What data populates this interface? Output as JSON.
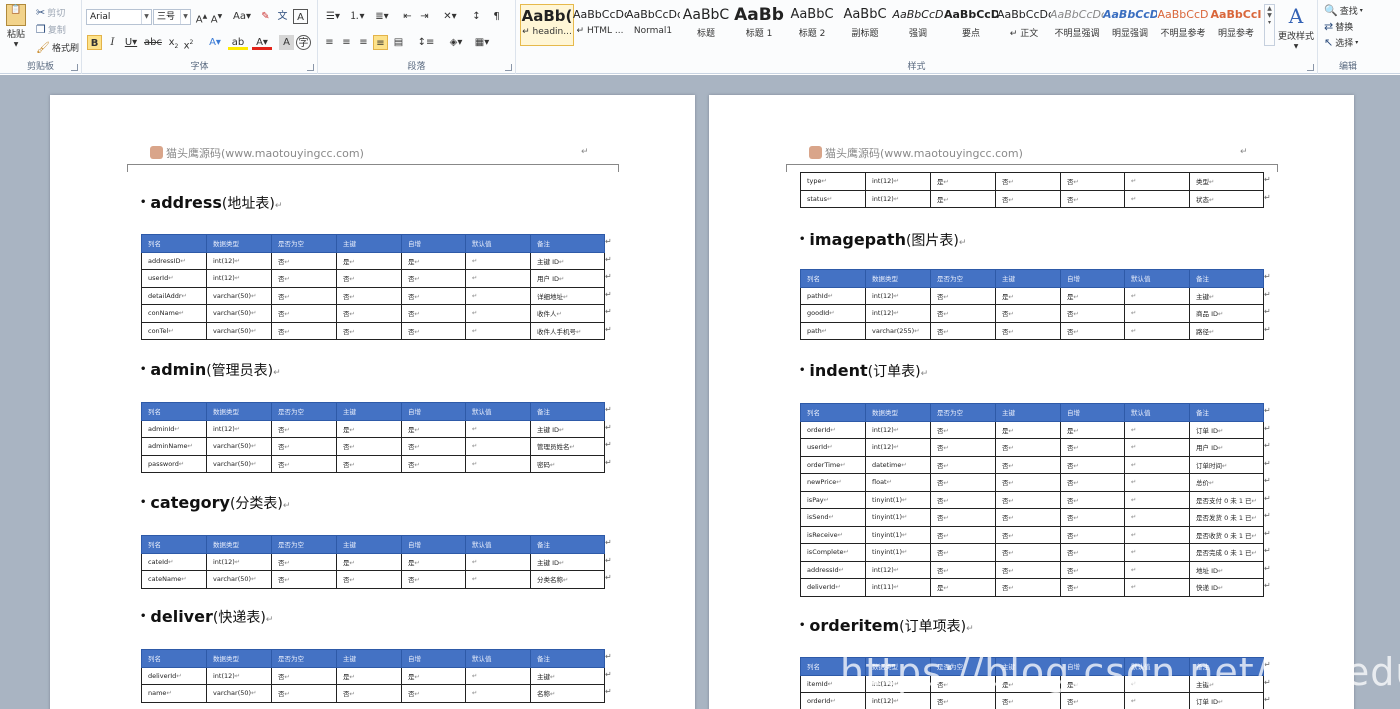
{
  "ribbon": {
    "clipboard": {
      "label": "剪贴板",
      "paste": "粘贴",
      "cut": "剪切",
      "copy": "复制",
      "format_painter": "格式刷"
    },
    "font": {
      "label": "字体",
      "font_name": "Arial",
      "font_size": "三号"
    },
    "paragraph": {
      "label": "段落"
    },
    "styles": {
      "label": "样式",
      "change_styles": "更改样式",
      "items": [
        {
          "sample": "AaBb(",
          "name": "headin..."
        },
        {
          "sample": "AaBbCcDc",
          "name": "HTML ..."
        },
        {
          "sample": "AaBbCcDd",
          "name": "Normal1"
        },
        {
          "sample": "AaBbC",
          "name": "标题"
        },
        {
          "sample": "AaBb",
          "name": "标题 1"
        },
        {
          "sample": "AaBbC",
          "name": "标题 2"
        },
        {
          "sample": "AaBbC",
          "name": "副标题"
        },
        {
          "sample": "AaBbCcD",
          "name": "强调"
        },
        {
          "sample": "AaBbCcD",
          "name": "要点"
        },
        {
          "sample": "AaBbCcDd",
          "name": "正文"
        },
        {
          "sample": "AaBbCcDc",
          "name": "不明显强调"
        },
        {
          "sample": "AaBbCcDc",
          "name": "明显强调"
        },
        {
          "sample": "AaBbCcD",
          "name": "不明显参考"
        },
        {
          "sample": "AaBbCcI",
          "name": "明显参考"
        }
      ]
    },
    "editing": {
      "label": "编辑",
      "find": "查找",
      "replace": "替换",
      "select": "选择"
    }
  },
  "document": {
    "header_text": "猫头鹰源码(www.maotouyingcc.com)",
    "columns": [
      "列名",
      "数据类型",
      "是否为空",
      "主键",
      "自增",
      "默认值",
      "备注"
    ],
    "left_page": [
      {
        "name": "address",
        "cn": "(地址表)",
        "rows": [
          [
            "addressID",
            "int(12)",
            "否",
            "是",
            "是",
            "",
            "主键 ID"
          ],
          [
            "userId",
            "int(12)",
            "否",
            "否",
            "否",
            "",
            "用户 ID"
          ],
          [
            "detailAddr",
            "varchar(50)",
            "否",
            "否",
            "否",
            "",
            "详细地址"
          ],
          [
            "conName",
            "varchar(50)",
            "否",
            "否",
            "否",
            "",
            "收件人"
          ],
          [
            "conTel",
            "varchar(50)",
            "否",
            "否",
            "否",
            "",
            "收件人手机号"
          ]
        ]
      },
      {
        "name": "admin",
        "cn": "(管理员表)",
        "rows": [
          [
            "adminId",
            "int(12)",
            "否",
            "是",
            "是",
            "",
            "主键 ID"
          ],
          [
            "adminName",
            "varchar(50)",
            "否",
            "否",
            "否",
            "",
            "管理员姓名"
          ],
          [
            "password",
            "varchar(50)",
            "否",
            "否",
            "否",
            "",
            "密码"
          ]
        ]
      },
      {
        "name": "category",
        "cn": "(分类表)",
        "rows": [
          [
            "cateId",
            "int(12)",
            "否",
            "是",
            "是",
            "",
            "主键 ID"
          ],
          [
            "cateName",
            "varchar(50)",
            "否",
            "否",
            "否",
            "",
            "分类名称"
          ]
        ]
      },
      {
        "name": "deliver",
        "cn": "(快递表)",
        "rows": [
          [
            "deliverId",
            "int(12)",
            "否",
            "是",
            "是",
            "",
            "主键"
          ],
          [
            "name",
            "varchar(50)",
            "否",
            "否",
            "否",
            "",
            "名称"
          ]
        ]
      }
    ],
    "right_page": {
      "continued_rows": [
        [
          "type",
          "int(12)",
          "是",
          "否",
          "否",
          "",
          "类型"
        ],
        [
          "status",
          "int(12)",
          "是",
          "否",
          "否",
          "",
          "状态"
        ]
      ],
      "tables": [
        {
          "name": "imagepath",
          "cn": "(图片表)",
          "rows": [
            [
              "pathId",
              "int(12)",
              "否",
              "是",
              "是",
              "",
              "主键"
            ],
            [
              "goodId",
              "int(12)",
              "否",
              "否",
              "否",
              "",
              "商品 ID"
            ],
            [
              "path",
              "varchar(255)",
              "否",
              "否",
              "否",
              "",
              "路径"
            ]
          ]
        },
        {
          "name": "indent",
          "cn": "(订单表)",
          "rows": [
            [
              "orderId",
              "int(12)",
              "否",
              "是",
              "是",
              "",
              "订单 ID"
            ],
            [
              "userId",
              "int(12)",
              "否",
              "否",
              "否",
              "",
              "用户 ID"
            ],
            [
              "orderTime",
              "datetime",
              "否",
              "否",
              "否",
              "",
              "订单时间"
            ],
            [
              "newPrice",
              "float",
              "否",
              "否",
              "否",
              "",
              "总价"
            ],
            [
              "isPay",
              "tinyint(1)",
              "否",
              "否",
              "否",
              "",
              "是否支付 0 未 1 已"
            ],
            [
              "isSend",
              "tinyint(1)",
              "否",
              "否",
              "否",
              "",
              "是否发货 0 未 1 已"
            ],
            [
              "isReceive",
              "tinyint(1)",
              "否",
              "否",
              "否",
              "",
              "是否收货 0 未 1 已"
            ],
            [
              "isComplete",
              "tinyint(1)",
              "否",
              "否",
              "否",
              "",
              "是否完成 0 未 1 已"
            ],
            [
              "addressId",
              "int(12)",
              "否",
              "否",
              "否",
              "",
              "地址 ID"
            ],
            [
              "deliverId",
              "int(11)",
              "是",
              "否",
              "否",
              "",
              "快递 ID"
            ]
          ]
        },
        {
          "name": "orderitem",
          "cn": "(订单项表)",
          "rows": [
            [
              "itemId",
              "int(12)",
              "否",
              "是",
              "是",
              "",
              "主键"
            ],
            [
              "orderId",
              "int(12)",
              "否",
              "否",
              "否",
              "",
              "订单 ID"
            ]
          ]
        }
      ]
    }
  },
  "watermark": "https://blog.csdn.net/mtyedu"
}
